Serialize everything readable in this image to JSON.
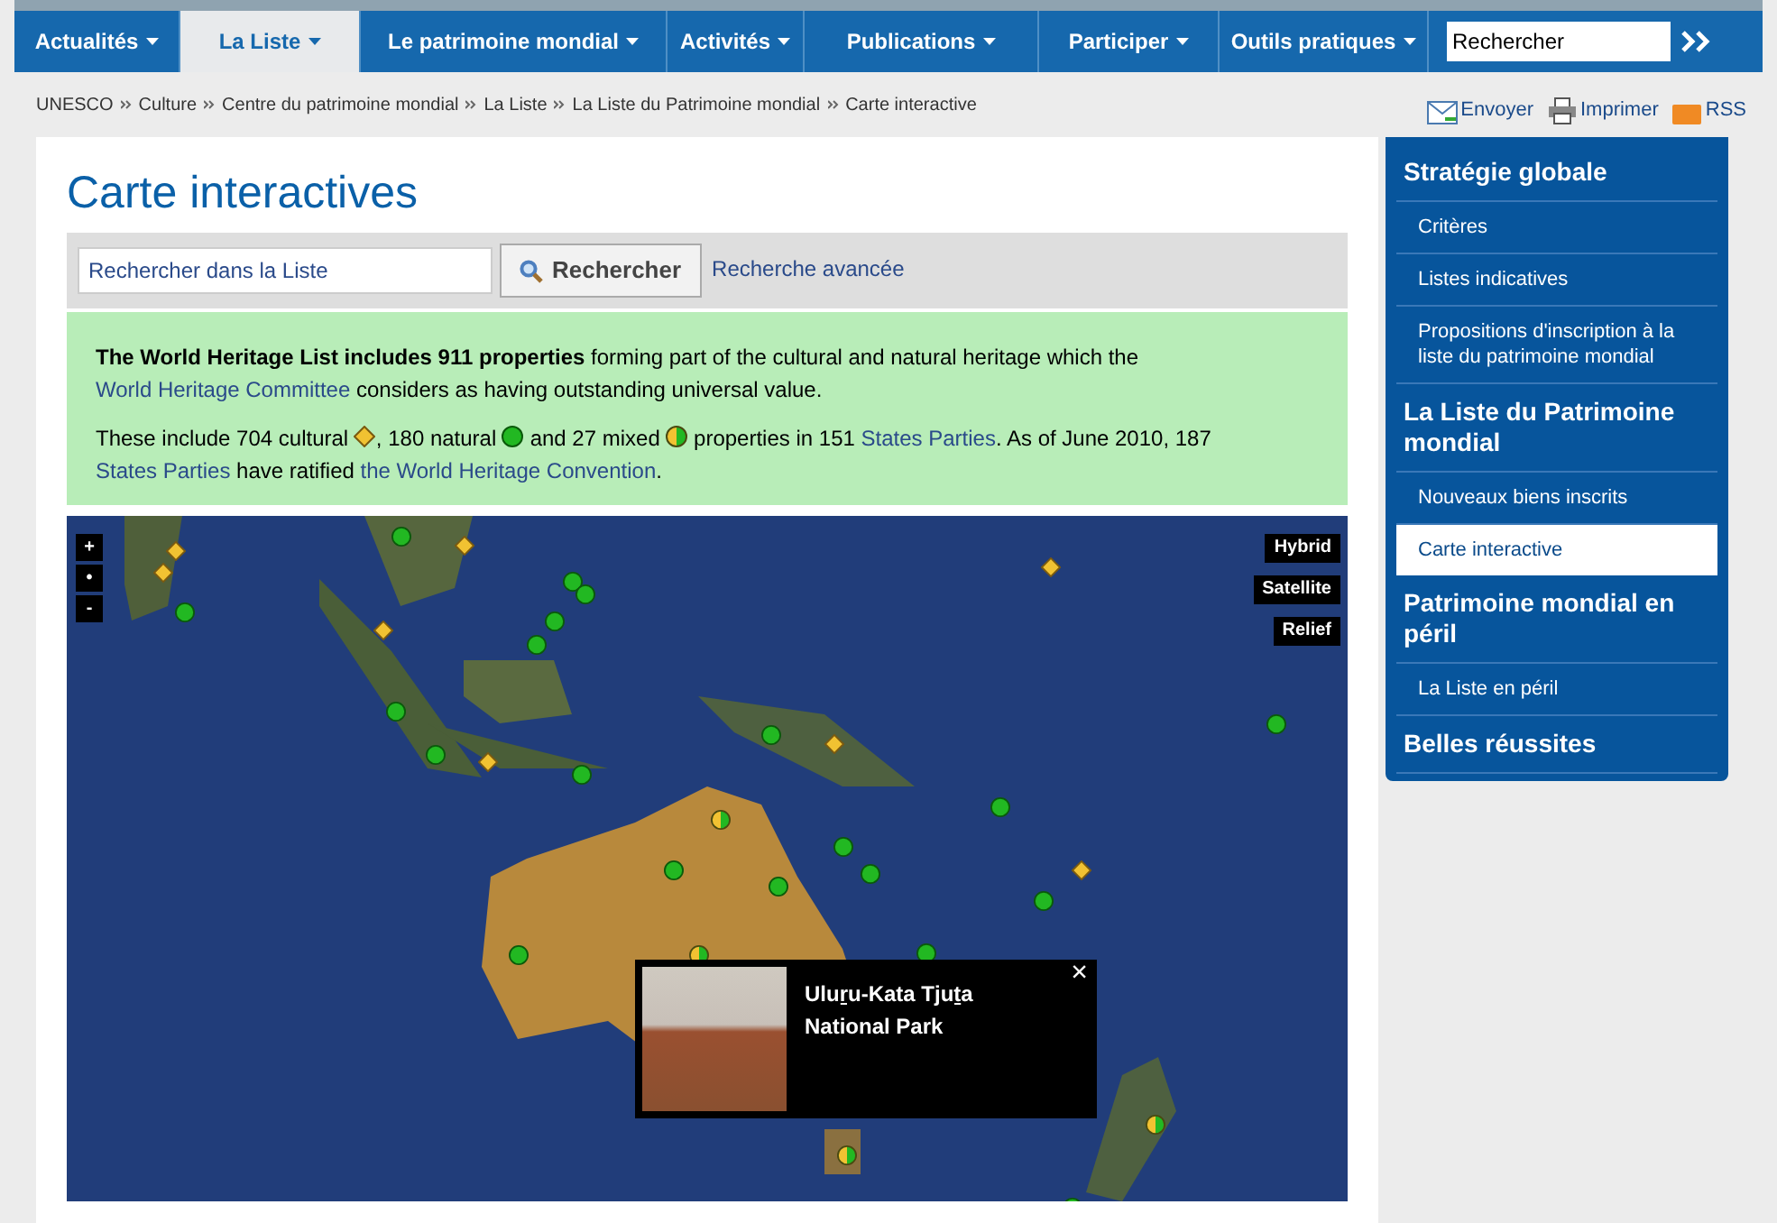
{
  "nav": {
    "tabs": [
      {
        "label": "Actualités",
        "selected": false
      },
      {
        "label": "La Liste",
        "selected": true
      },
      {
        "label": "Le patrimoine mondial",
        "selected": false
      },
      {
        "label": "Activités",
        "selected": false
      },
      {
        "label": "Publications",
        "selected": false
      },
      {
        "label": "Participer",
        "selected": false
      },
      {
        "label": "Outils pratiques",
        "selected": false
      }
    ],
    "search_value": "Rechercher"
  },
  "breadcrumb": [
    "UNESCO",
    "Culture",
    "Centre du patrimoine mondial",
    "La Liste",
    "La Liste du Patrimoine mondial",
    "Carte interactive"
  ],
  "actions": [
    {
      "kind": "mail",
      "label": "Envoyer"
    },
    {
      "kind": "print",
      "label": "Imprimer"
    },
    {
      "kind": "rss",
      "label": "RSS"
    }
  ],
  "title": "Carte interactives",
  "search": {
    "value": "Rechercher dans la Liste",
    "button": "Rechercher",
    "advanced": "Recherche avancée"
  },
  "intro": [
    [
      {
        "kind": "text",
        "text": "**The World Heritage List includes 911 properties** forming part of the cultural and natural heritage which the "
      },
      {
        "kind": "link",
        "text": "World Heritage Committee"
      },
      {
        "kind": "text",
        "text": " considers as having outstanding universal value."
      }
    ],
    [
      {
        "kind": "text",
        "text": "These include 704 cultural "
      },
      {
        "kind": "cultural"
      },
      {
        "kind": "text",
        "text": ", 180 natural "
      },
      {
        "kind": "natural"
      },
      {
        "kind": "text",
        "text": " and 27 mixed "
      },
      {
        "kind": "mixed"
      },
      {
        "kind": "text",
        "text": " properties in 151 "
      },
      {
        "kind": "link",
        "text": "States Parties"
      },
      {
        "kind": "text",
        "text": ". As of June 2010, 187 "
      },
      {
        "kind": "link",
        "text": "States Parties"
      },
      {
        "kind": "text",
        "text": " have ratified "
      },
      {
        "kind": "link",
        "text": "the World Heritage Convention"
      },
      {
        "kind": "text",
        "text": "."
      }
    ]
  ],
  "map": {
    "zoom_buttons": [
      "+",
      "•",
      "-"
    ],
    "layers": [
      "Hybrid",
      "Satellite",
      "Relief"
    ],
    "popup": {
      "title": "Uluṟu-Kata Tjuṯa National Park",
      "close": "×"
    }
  },
  "sidebar": [
    {
      "kind": "heading",
      "label": "Stratégie globale",
      "selected": false
    },
    {
      "kind": "item",
      "label": "Critères",
      "selected": false
    },
    {
      "kind": "item",
      "label": "Listes indicatives",
      "selected": false
    },
    {
      "kind": "item",
      "label": "Propositions d'inscription à la liste du patrimoine mondial",
      "selected": false
    },
    {
      "kind": "heading",
      "label": "La Liste du Patrimoine mondial",
      "selected": false
    },
    {
      "kind": "item",
      "label": "Nouveaux biens inscrits",
      "selected": false
    },
    {
      "kind": "item",
      "label": "Carte interactive",
      "selected": true
    },
    {
      "kind": "heading",
      "label": "Patrimoine mondial en péril",
      "selected": false
    },
    {
      "kind": "item",
      "label": "La Liste en péril",
      "selected": false
    },
    {
      "kind": "heading",
      "label": "Belles réussites",
      "selected": false
    }
  ]
}
